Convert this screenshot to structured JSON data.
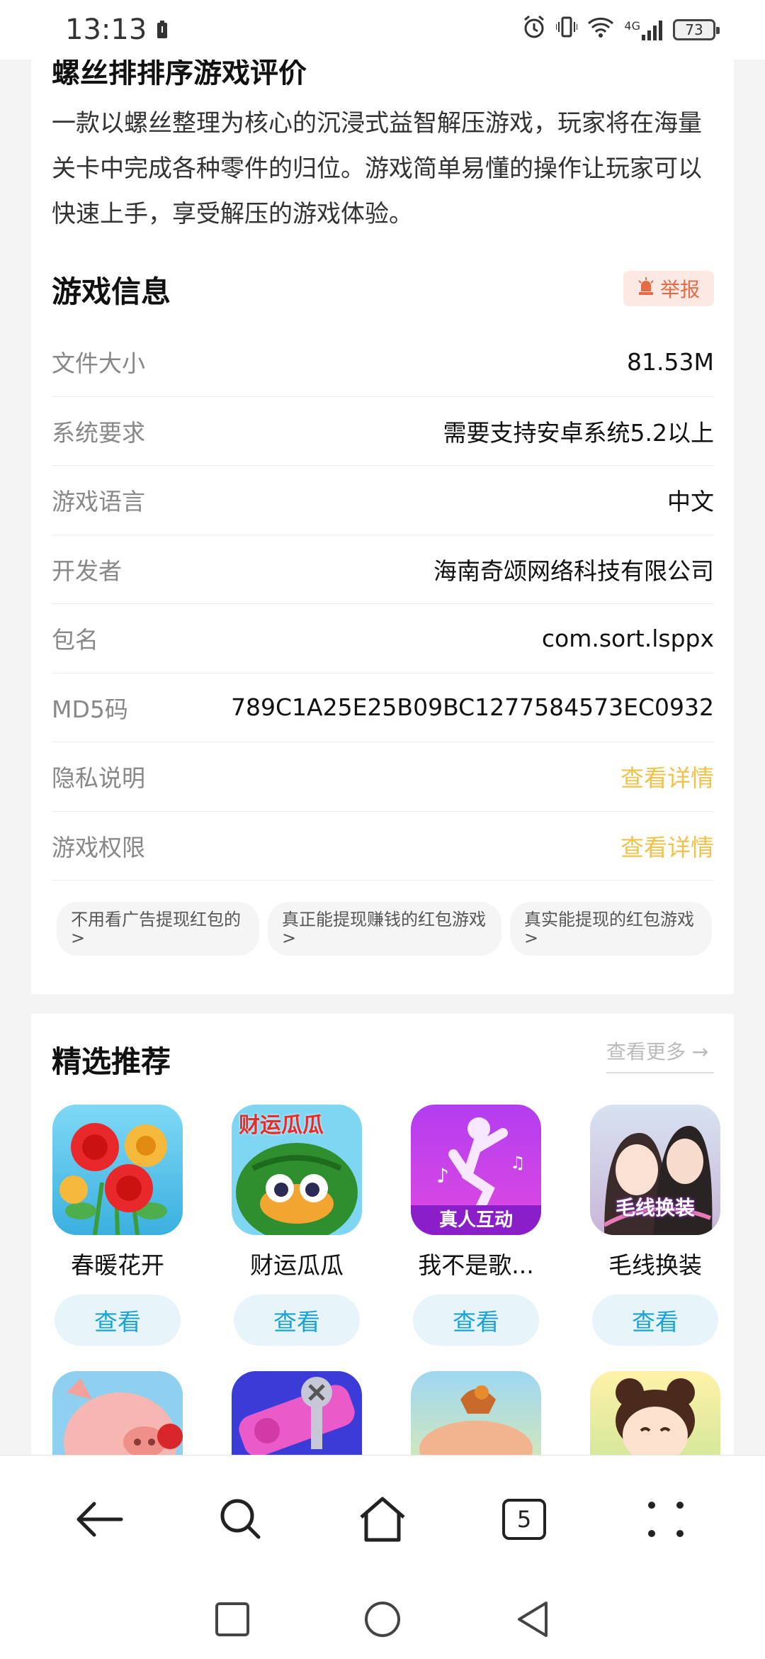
{
  "status_bar": {
    "time": "13:13",
    "network_label": "4G",
    "battery_level": "73"
  },
  "description": {
    "title": "螺丝排排序游戏评价",
    "text": "一款以螺丝整理为核心的沉浸式益智解压游戏，玩家将在海量关卡中完成各种零件的归位。游戏简单易懂的操作让玩家可以快速上手，享受解压的游戏体验。"
  },
  "game_info": {
    "title": "游戏信息",
    "report_label": "举报",
    "rows": [
      {
        "label": "文件大小",
        "value": "81.53M"
      },
      {
        "label": "系统要求",
        "value": "需要支持安卓系统5.2以上"
      },
      {
        "label": "游戏语言",
        "value": "中文"
      },
      {
        "label": "开发者",
        "value": "海南奇颂网络科技有限公司"
      },
      {
        "label": "包名",
        "value": "com.sort.lsppx"
      },
      {
        "label": "MD5码",
        "value": "789C1A25E25B09BC1277584573EC0932"
      },
      {
        "label": "隐私说明",
        "value": "查看详情"
      },
      {
        "label": "游戏权限",
        "value": "查看详情"
      }
    ],
    "tags": [
      "不用看广告提现红包的 >",
      "真正能提现赚钱的红包游戏 >",
      "真实能提现的红包游戏 >"
    ]
  },
  "recommend": {
    "title": "精选推荐",
    "more_label": "查看更多 →",
    "apps": [
      {
        "name": "春暖花开",
        "button": "查看",
        "icon": "flowers-icon"
      },
      {
        "name": "财运瓜瓜",
        "button": "查看",
        "icon": "watermelon-icon",
        "icon_text": "财运瓜瓜"
      },
      {
        "name": "我不是歌...",
        "button": "查看",
        "icon": "dancer-icon",
        "icon_text": "真人互动"
      },
      {
        "name": "毛线换装",
        "button": "查看",
        "icon": "couple-icon",
        "icon_text": "毛线换装"
      }
    ]
  },
  "bottom_nav": {
    "tab_count": "5"
  },
  "colors": {
    "link_yellow": "#f0c24a",
    "view_button_bg": "#e7f5fb",
    "view_button_text": "#1ba3d6",
    "report_bg": "#fde9e4",
    "report_text": "#e56b46"
  }
}
